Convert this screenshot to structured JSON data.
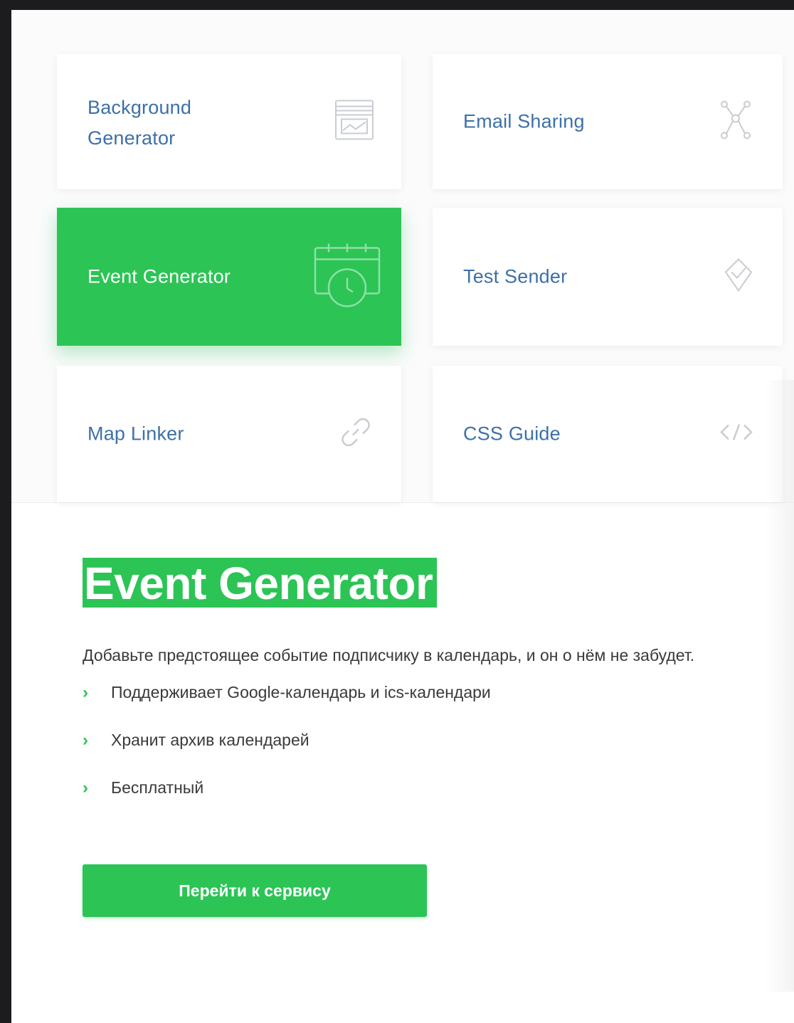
{
  "services": [
    {
      "label": "Background\nGenerator",
      "icon": "background-generator-icon",
      "active": false
    },
    {
      "label": "Email Sharing",
      "icon": "share-network-icon",
      "active": false
    },
    {
      "label": "Event Generator",
      "icon": "calendar-clock-icon",
      "active": true
    },
    {
      "label": "Test Sender",
      "icon": "send-test-icon",
      "active": false
    },
    {
      "label": "Map Linker",
      "icon": "link-icon",
      "active": false
    },
    {
      "label": "CSS Guide",
      "icon": "code-icon",
      "active": false
    }
  ],
  "detail": {
    "title": "Event Generator",
    "description": "Добавьте предстоящее событие подписчику в календарь, и он о нём не забудет.",
    "features": [
      "Поддерживает Google-календарь и ics-календари",
      "Хранит архив календарей",
      "Бесплатный"
    ],
    "cta_label": "Перейти к сервису"
  },
  "colors": {
    "accent": "#2cc455",
    "link": "#3d70a8",
    "text": "#3a3a3a",
    "frame": "#1c1c1e"
  }
}
